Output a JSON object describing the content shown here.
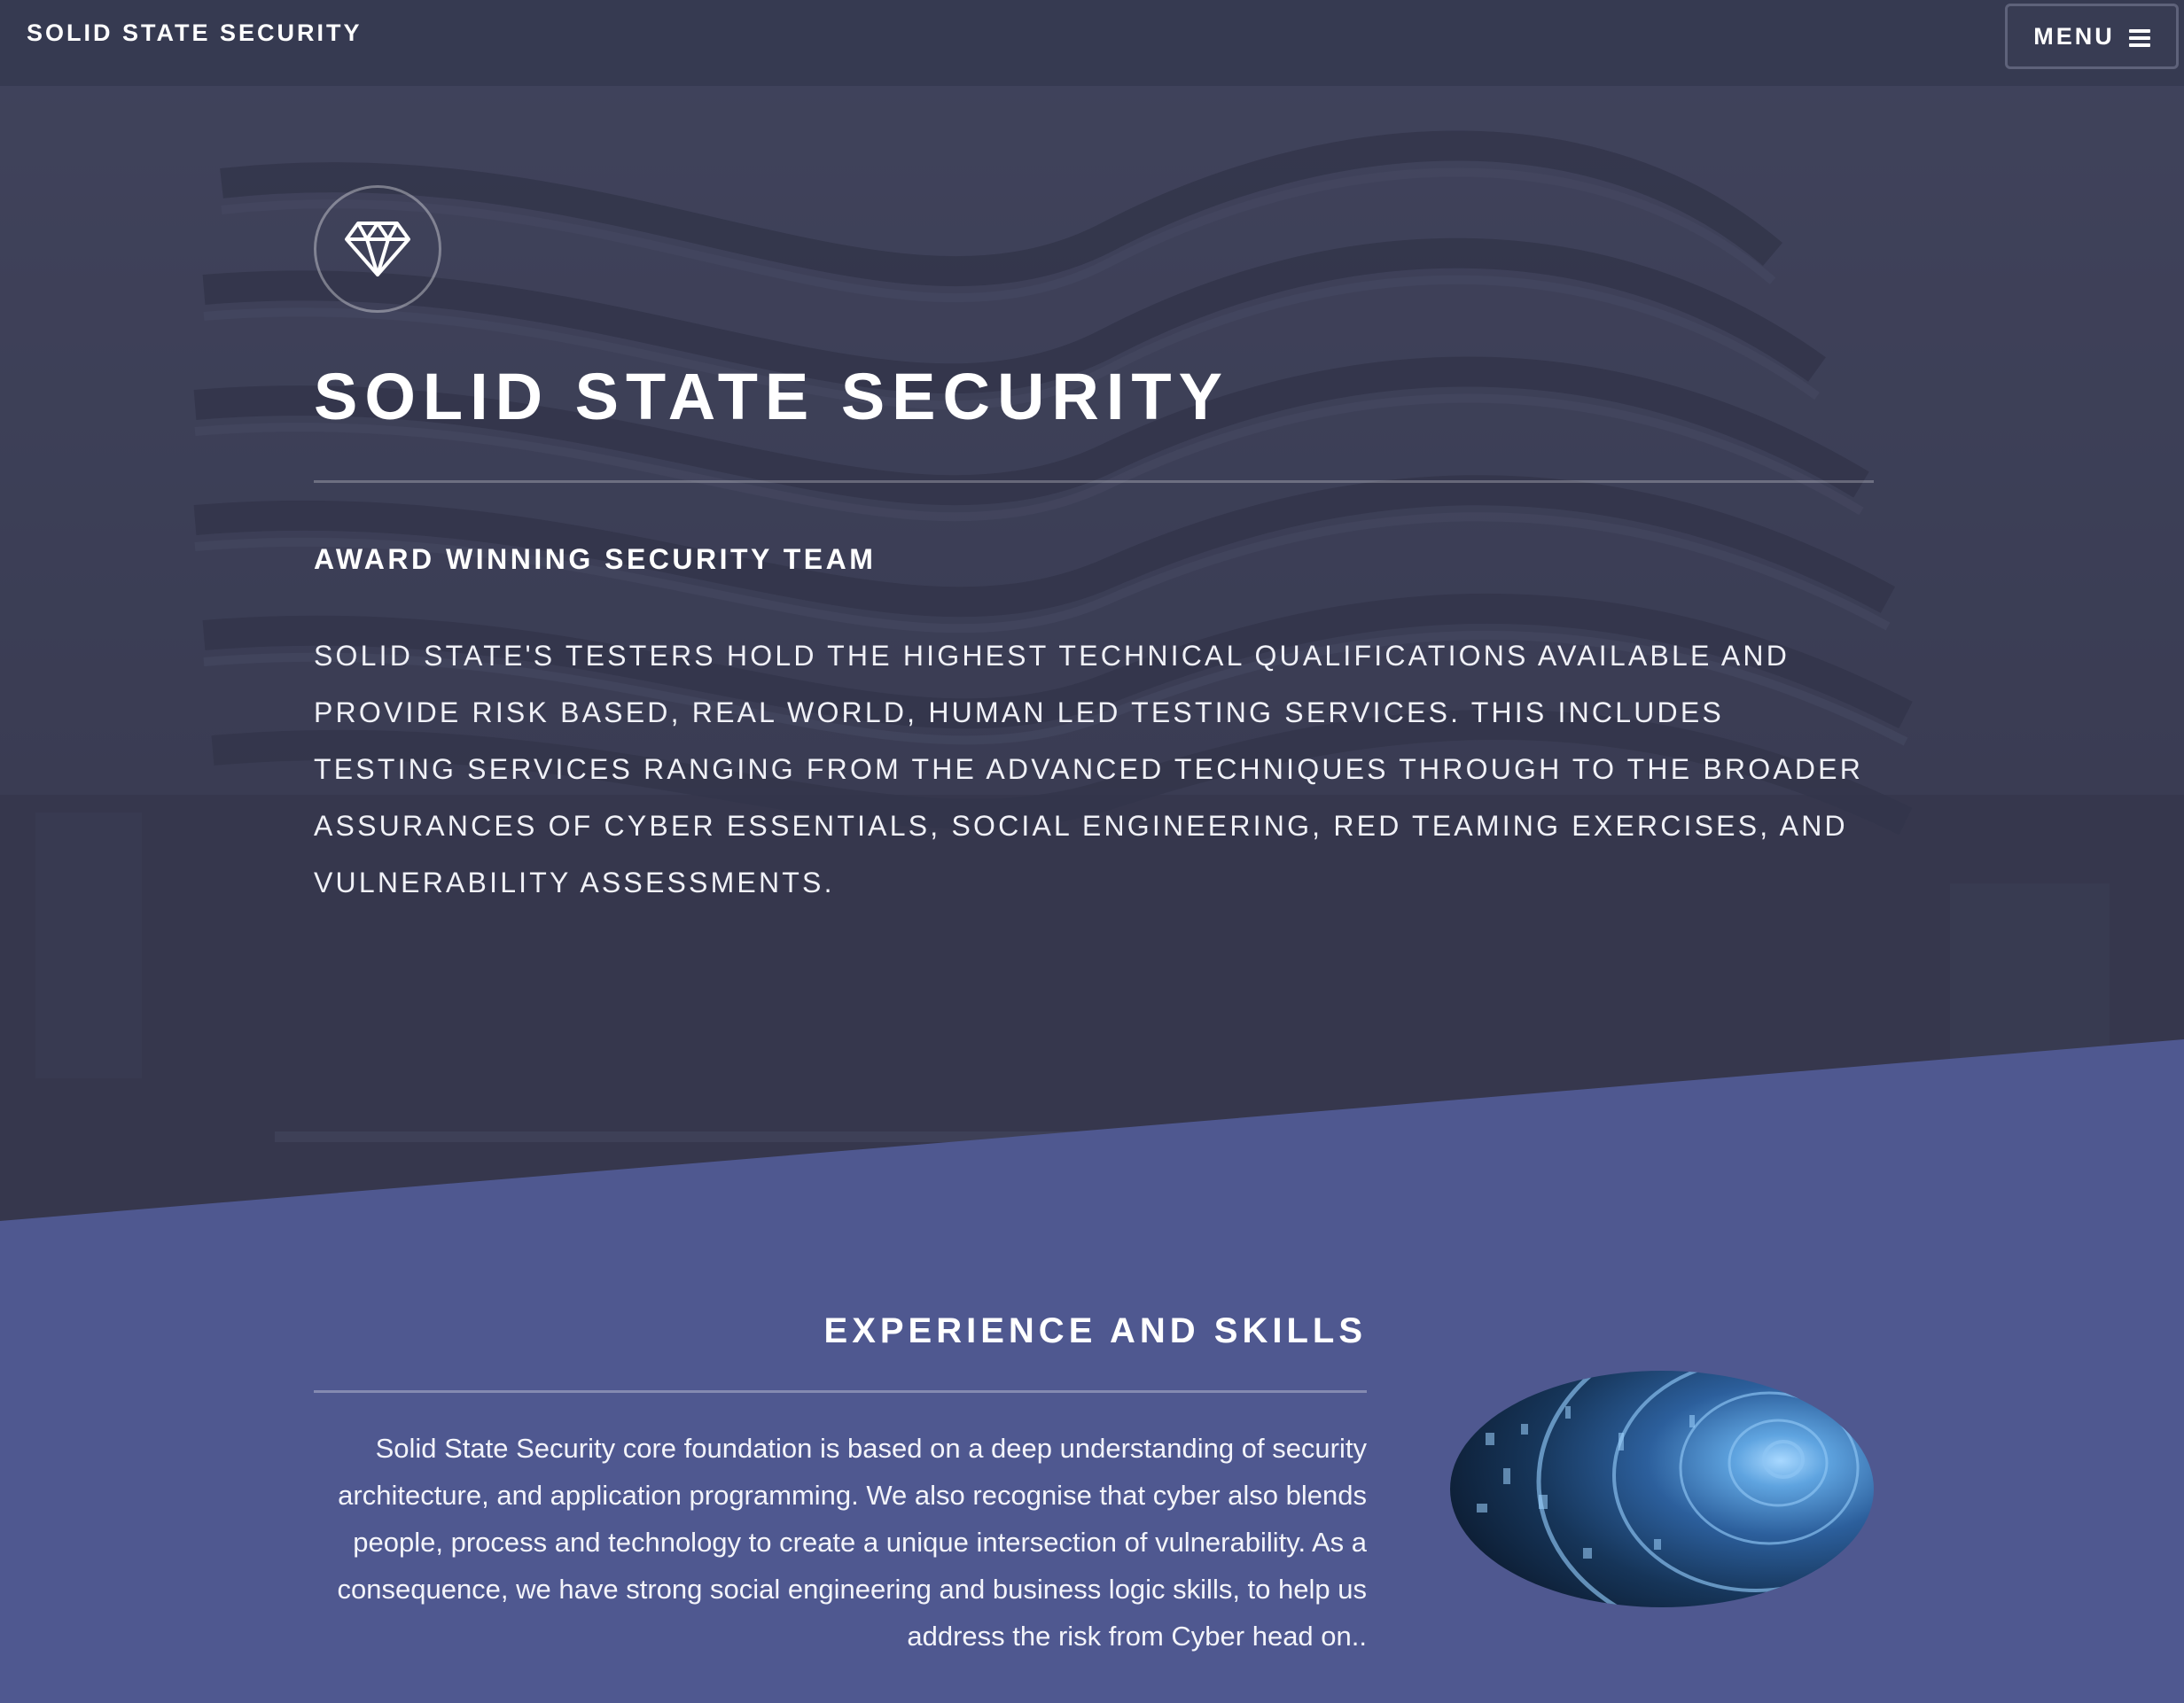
{
  "header": {
    "brand": "SOLID STATE SECURITY",
    "menu_label": "MENU"
  },
  "hero": {
    "logo_icon": "diamond-icon",
    "title": "SOLID STATE SECURITY",
    "subtitle": "AWARD WINNING SECURITY TEAM",
    "text": "Solid State's testers hold the highest technical qualifications available and provide risk based, real world, human led testing services. This includes testing services ranging from the advanced techniques through to the broader assurances of Cyber Essentials, Social Engineering, Red Teaming Exercises, and vulnerability assessments."
  },
  "skills": {
    "title": "EXPERIENCE AND SKILLS",
    "body": "Solid State Security core foundation is based on a deep understanding of security architecture, and application programming. We also recognise that cyber also blends people, process and technology to create a unique intersection of vulnerability. As a consequence, we have strong social engineering and business logic skills, to help us address the risk from Cyber head on..",
    "image_icon": "cyber-tunnel-image"
  },
  "colors": {
    "header_bg": "#363a51",
    "section_bg": "#4f5890",
    "hero_overlay": "#363950"
  }
}
